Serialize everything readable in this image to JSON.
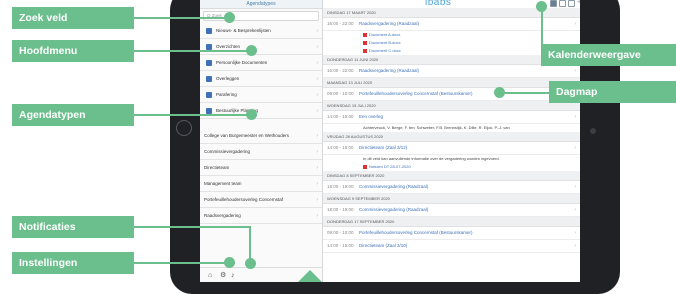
{
  "sidebar": {
    "title": "Agendatypes",
    "search_placeholder": "Q Zoek",
    "menu_items": [
      {
        "label": "Nieuws- & Besprekenlijsten",
        "icon": "list-icon"
      },
      {
        "label": "Overzichten",
        "icon": "chart-icon"
      },
      {
        "label": "Persoonlijke Documenten",
        "icon": "document-icon"
      },
      {
        "label": "Overleggen",
        "icon": "people-icon"
      },
      {
        "label": "Parafering",
        "icon": "pen-icon"
      },
      {
        "label": "Bestuurlijke Planning",
        "icon": "calendar-icon"
      }
    ],
    "agenda_types": [
      "College van Burgemeester en Wethouders",
      "Commissievergadering",
      "Directieteam",
      "Management team",
      "Portefeuillehoudersoverleg Concernstaf",
      "Raadsvergadering"
    ],
    "bottom_icons": [
      "home-icon",
      "gear-icon",
      "bell-icon"
    ]
  },
  "header": {
    "logo": "ibabs"
  },
  "agenda": {
    "day1": {
      "date": "DINSDAG 17 MAART 2020"
    },
    "event1": {
      "time": "16:00 - 22:00",
      "title": "Raadsvergadering (Raadzaal)"
    },
    "docs": [
      "Document A.docx",
      "Document B.docx",
      "Document C.docx"
    ],
    "day2": {
      "date": "DONDERDAG 11 JUNI 2020"
    },
    "event2": {
      "time": "16:00 - 22:00",
      "title": "Raadsvergadering (Raadzaal)"
    },
    "day3": {
      "date": "MAANDAG 13 JULI 2020"
    },
    "event3": {
      "time": "09:00 - 10:00",
      "title": "Portefeuillehoudersoverleg Concernstaf (Bestuurskamer)"
    },
    "day4": {
      "date": "WOENSDAG 15 JULI 2020"
    },
    "event4": {
      "time": "14:00 - 16:00",
      "title": "Een overleg"
    },
    "event4_people": "Achterveuck, V. Berge, F. ten; Schweiter, F.B. Brennslijk, K. Dille, R. Eijck, P.-J. van",
    "day5": {
      "date": "VRIJDAG 28 AUGUSTUS 2020"
    },
    "event5": {
      "time": "14:00 - 16:00",
      "title": "Directieteam (Zaal 3/12)"
    },
    "event5_note": "In dit veld kan aanvullende informatie over de vergadering worden ingevoerd.",
    "event5_doc": "Notulen DT 28-07-2020",
    "day6": {
      "date": "DINSDAG 8 SEPTEMBER 2020"
    },
    "event6": {
      "time": "18:00 - 19:00",
      "title": "Commissievergadering (Raadzaal)"
    },
    "day7": {
      "date": "WOENSDAG 9 SEPTEMBER 2020"
    },
    "event7": {
      "time": "18:00 - 19:00",
      "title": "Commissievergadering (Raadzaal)"
    },
    "day8": {
      "date": "DONDERDAG 17 SEPTEMBER 2020"
    },
    "event8": {
      "time": "09:00 - 10:00",
      "title": "Portefeuillehoudersoverleg Concernstaf (Bestuurskamer)"
    },
    "event9": {
      "time": "14:00 - 15:00",
      "title": "Directieteam (Zaal 3/10)"
    }
  },
  "callouts": {
    "zoek_veld": "Zoek veld",
    "hoofdmenu": "Hoofdmenu",
    "agendatypen": "Agendatypen",
    "notificaties": "Notificaties",
    "instellingen": "Instellingen",
    "kalenderweergave": "Kalenderweergave",
    "dagmap": "Dagmap"
  },
  "colors": {
    "callout_green": "#6bbf8d",
    "link_blue": "#3f72b8",
    "logo_blue": "#4aa3d8"
  }
}
